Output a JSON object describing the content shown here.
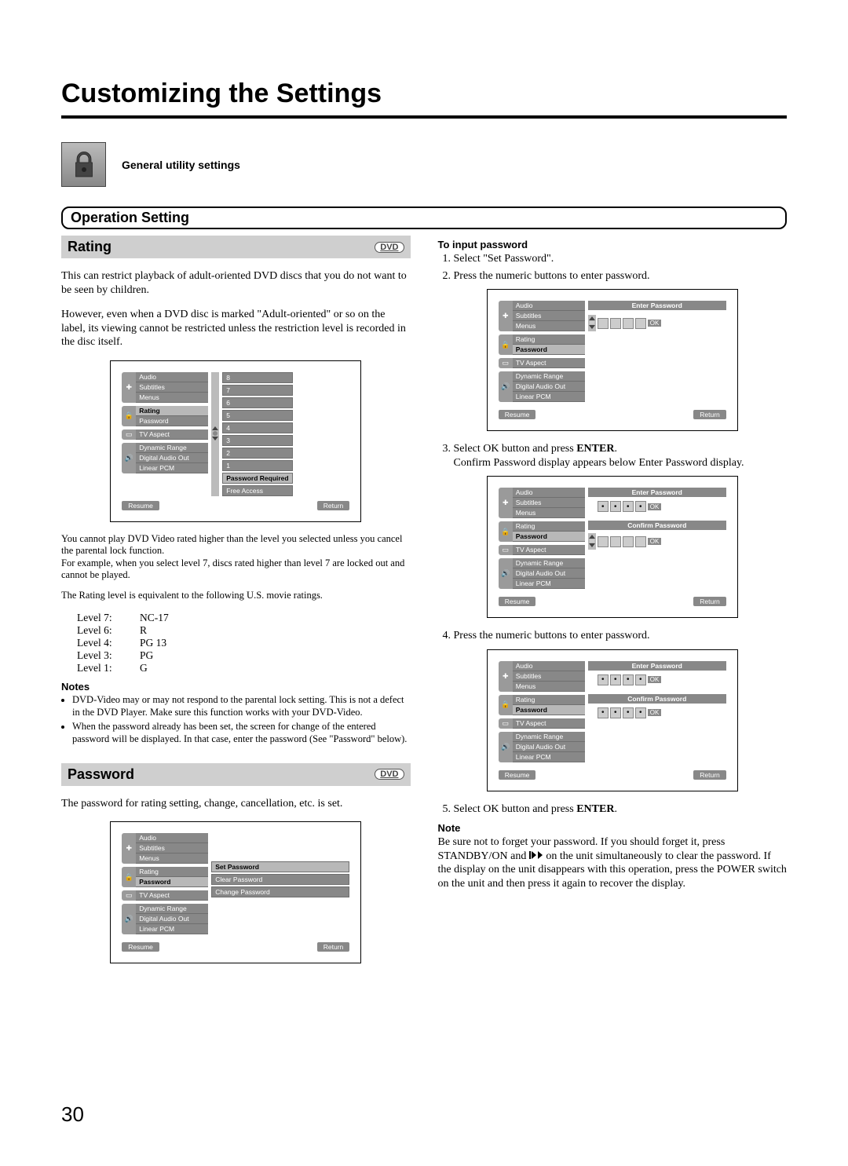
{
  "page_number": "30",
  "title": "Customizing the Settings",
  "lead_label": "General utility settings",
  "section_heading": "Operation Setting",
  "rating": {
    "heading": "Rating",
    "badge": "DVD",
    "p1": "This can restrict playback of adult-oriented DVD discs that you do not want to be seen by children.",
    "p2": "However, even when a DVD disc is marked \"Adult-oriented\" or so on the label, its viewing cannot be restricted unless the restriction level is recorded in the disc itself.",
    "note_below1": "You cannot play DVD Video rated higher than the level you selected unless you cancel the parental lock function.",
    "note_below2": "For example, when you select level 7, discs rated higher than level 7 are locked out and cannot be played.",
    "equiv": "The Rating level is equivalent to the following U.S. movie ratings.",
    "levels": [
      {
        "lv": "Level 7:",
        "rv": "NC-17"
      },
      {
        "lv": "Level 6:",
        "rv": "R"
      },
      {
        "lv": "Level 4:",
        "rv": "PG 13"
      },
      {
        "lv": "Level 3:",
        "rv": "PG"
      },
      {
        "lv": "Level 1:",
        "rv": "G"
      }
    ],
    "notes_head": "Notes",
    "notes": [
      "DVD-Video may or may not respond to the parental lock setting. This is not a defect in the DVD Player. Make sure this function works with your DVD-Video.",
      "When the password already has been set, the screen for change of the entered password will be displayed. In that case, enter the password (See \"Password\" below)."
    ]
  },
  "password": {
    "heading": "Password",
    "badge": "DVD",
    "p1": "The password for rating setting, change, cancellation, etc. is set."
  },
  "right": {
    "input_head": "To input password",
    "step1": "Select \"Set Password\".",
    "step2": "Press the numeric buttons to enter password.",
    "step3a": "Select OK button and press ",
    "step3b": "ENTER",
    "step3c": ".",
    "step3d": "Confirm Password display appears below Enter Password display.",
    "step4": "Press the numeric buttons to enter password.",
    "step5a": "Select OK button and press ",
    "step5b": "ENTER",
    "step5c": ".",
    "note_head": "Note",
    "note_body_a": "Be sure not to forget your password. If you should forget it, press STANDBY/ON and ",
    "note_body_b": " on the unit simultaneously to clear the password. If the display on the unit disappears with this operation, press the POWER switch on the unit and then press it again to recover the display."
  },
  "osd": {
    "groups": {
      "g1": [
        "Audio",
        "Subtitles",
        "Menus"
      ],
      "g2": [
        "Rating",
        "Password"
      ],
      "g3": [
        "TV Aspect"
      ],
      "g4": [
        "Dynamic Range",
        "Digital Audio Out",
        "Linear PCM"
      ]
    },
    "rating_right": [
      "8",
      "7",
      "6",
      "5",
      "4",
      "3",
      "2",
      "1",
      "Password Required",
      "Free Access"
    ],
    "pw_right": [
      "Set Password",
      "Clear Password",
      "Change Password"
    ],
    "enter_pw": "Enter Password",
    "confirm_pw": "Confirm Password",
    "ok": "OK",
    "resume": "Resume",
    "return": "Return"
  }
}
